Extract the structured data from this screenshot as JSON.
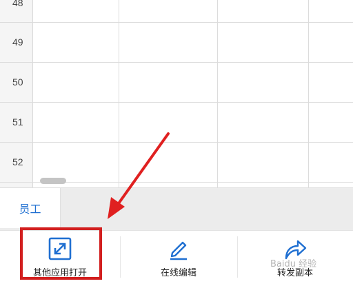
{
  "sheet": {
    "rows": [
      {
        "num": "48"
      },
      {
        "num": "49"
      },
      {
        "num": "50"
      },
      {
        "num": "51"
      },
      {
        "num": "52"
      }
    ]
  },
  "tabs": {
    "active_label": "员工"
  },
  "toolbar": {
    "open_other_app_label": "其他应用打开",
    "online_edit_label": "在线编辑",
    "forward_copy_label": "转发副本"
  },
  "watermark": {
    "text": "Baidu 经验"
  },
  "colors": {
    "accent": "#1f6fd1",
    "highlight": "#d21f1f"
  },
  "icons": {
    "open_other_app": "expand-arrows-icon",
    "online_edit": "pencil-icon",
    "forward_copy": "share-arrow-icon"
  }
}
